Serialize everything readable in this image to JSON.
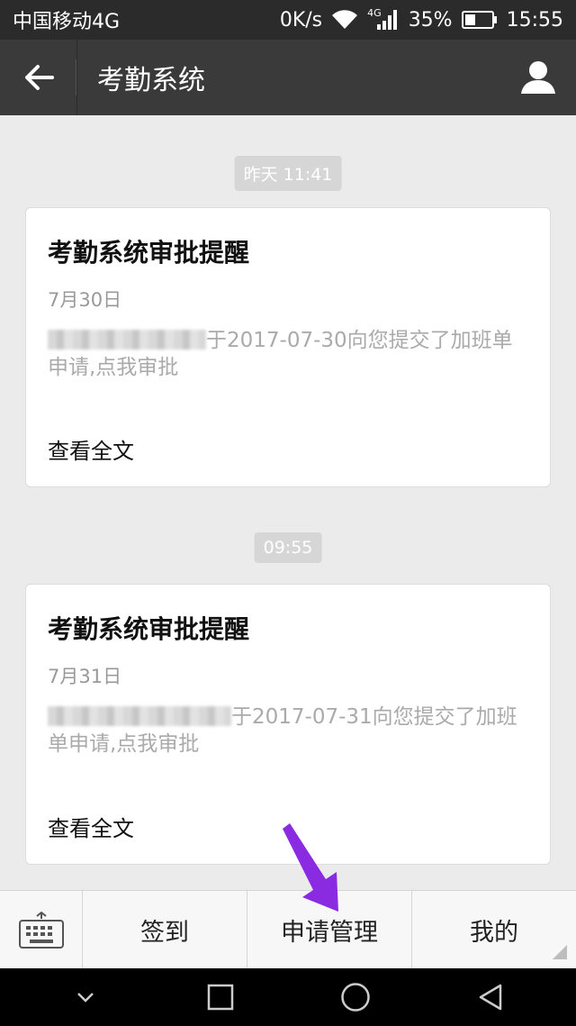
{
  "status_bar": {
    "carrier": "中国移动4G",
    "speed": "0K/s",
    "network_small": "4G",
    "battery_percent": "35%",
    "time": "15:55"
  },
  "title_bar": {
    "title": "考勤系统"
  },
  "messages": [
    {
      "timestamp": "昨天 11:41",
      "title": "考勤系统审批提醒",
      "date": "7月30日",
      "body_line1": "于2017-07-30向您提交了加班单",
      "body_line2": "申请,点我审批",
      "footer": "查看全文"
    },
    {
      "timestamp": "09:55",
      "title": "考勤系统审批提醒",
      "date": "7月31日",
      "body_line1": "于2017-07-31向您提交了加班",
      "body_line2": "单申请,点我审批",
      "footer": "查看全文"
    }
  ],
  "bottom_menu": {
    "items": [
      "签到",
      "申请管理",
      "我的"
    ]
  },
  "colors": {
    "annotation_arrow": "#8a2be2",
    "title_bar": "#3a3a3a",
    "status_bar": "#2b2b2b"
  }
}
